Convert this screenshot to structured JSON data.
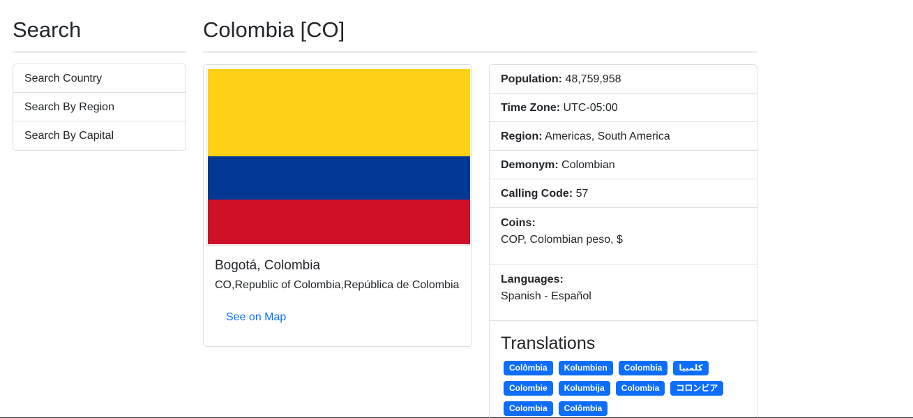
{
  "sidebar": {
    "title": "Search",
    "items": [
      {
        "label": "Search Country"
      },
      {
        "label": "Search By Region"
      },
      {
        "label": "Search By Capital"
      }
    ]
  },
  "country": {
    "title": "Colombia [CO]",
    "flag_colors": [
      "#fcd116",
      "#003893",
      "#ce1126"
    ],
    "capital": "Bogotá, Colombia",
    "alt_names": "CO,Republic of Colombia,República de Colombia",
    "map_link": "See on Map"
  },
  "info": {
    "population": {
      "label": "Population:",
      "value": "48,759,958"
    },
    "timezone": {
      "label": "Time Zone:",
      "value": "UTC-05:00"
    },
    "region": {
      "label": "Region:",
      "value": "Americas, South America"
    },
    "demonym": {
      "label": "Demonym:",
      "value": "Colombian"
    },
    "calling_code": {
      "label": "Calling Code:",
      "value": "57"
    },
    "coins": {
      "label": "Coins:",
      "value": "COP, Colombian peso, $"
    },
    "languages": {
      "label": "Languages:",
      "value": "Spanish - Español"
    }
  },
  "translations": {
    "title": "Translations",
    "items": [
      "Colômbia",
      "Kolumbien",
      "Colombia",
      "کلمبیا",
      "Colombie",
      "Kolumbija",
      "Colombia",
      "コロンビア",
      "Colombia",
      "Colômbia"
    ]
  }
}
